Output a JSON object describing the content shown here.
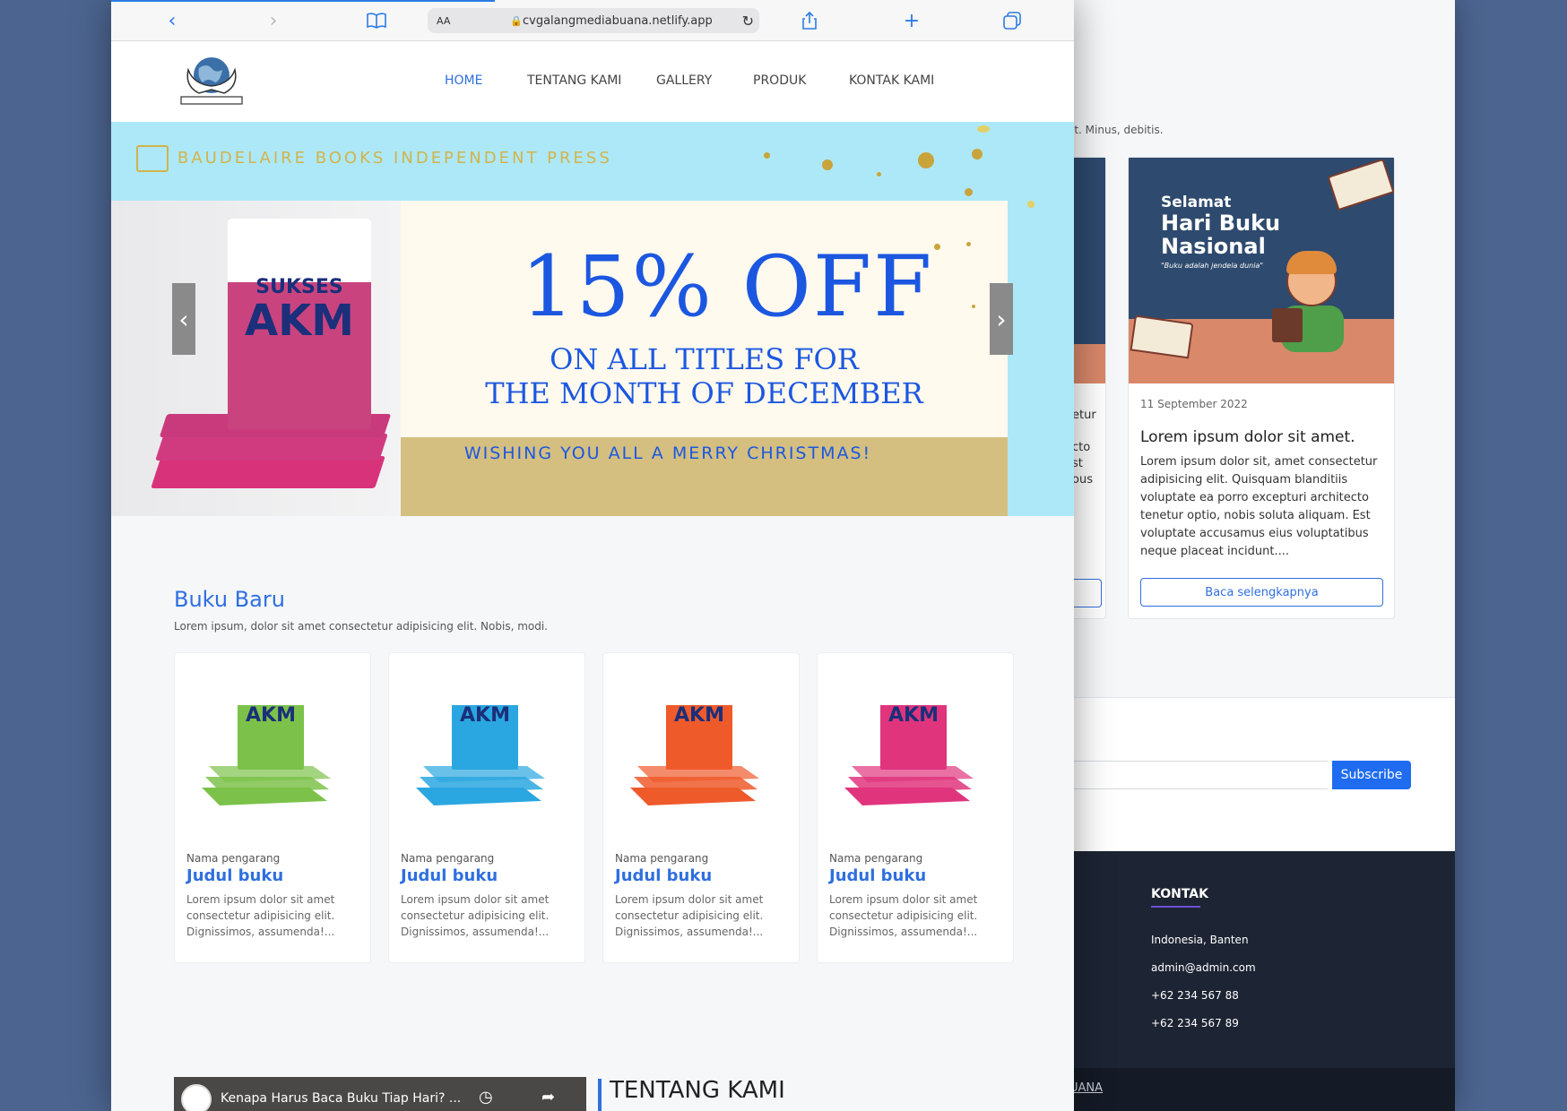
{
  "back": {
    "lead_fragment": "it. Minus, debitis.",
    "left_card_fragments": [
      "etur",
      "cto",
      "st",
      "ous"
    ],
    "main_card": {
      "image_line1": "Selamat",
      "image_line2": "Hari Buku Nasional",
      "image_quote": "\"Buku adalah jendela dunia\"",
      "date": "11 September 2022",
      "title": "Lorem ipsum dolor sit amet.",
      "text": "Lorem ipsum dolor sit, amet consectetur adipisicing elit. Quisquam blanditiis voluptate ea porro excepturi architecto tenetur optio, nobis soluta aliquam. Est voluptate accusamus eius voluptatibus neque placeat incidunt....",
      "button": "Baca selengkapnya"
    },
    "subscribe_button": "Subscribe",
    "footer": {
      "heading": "KONTAK",
      "items": [
        "Indonesia, Banten",
        "admin@admin.com",
        "+62 234 567 88",
        "+62 234 567 89"
      ],
      "bottom_link": "UANA"
    }
  },
  "browser": {
    "url_aa": "AA",
    "url": "cvgalangmediabuana.netlify.app",
    "icons": [
      "back-icon",
      "forward-icon",
      "bookmarks-icon",
      "lock-icon",
      "reload-icon",
      "share-icon",
      "new-tab-icon",
      "tabs-icon"
    ]
  },
  "nav": {
    "items": [
      "HOME",
      "TENTANG KAMI",
      "GALLERY",
      "PRODUK",
      "KONTAK KAMI"
    ],
    "active": "HOME"
  },
  "hero": {
    "brand": "BAUDELAIRE BOOKS INDEPENDENT PRESS",
    "headline": "15% OFF",
    "sub_line1": "ON ALL TITLES FOR",
    "sub_line2": "THE MONTH OF DECEMBER",
    "greeting": "WISHING YOU ALL A MERRY CHRISTMAS!",
    "book_title": "AKM",
    "book_sub": "SUKSES"
  },
  "buku_baru": {
    "heading": "Buku Baru",
    "subtitle": "Lorem ipsum, dolor sit amet consectetur adipisicing elit. Nobis, modi.",
    "books": [
      {
        "author": "Nama pengarang",
        "title": "Judul buku",
        "desc": "Lorem ipsum dolor sit amet consectetur adipisicing elit. Dignissimos, assumenda!...",
        "color": "#7cc24a",
        "label": "AKM"
      },
      {
        "author": "Nama pengarang",
        "title": "Judul buku",
        "desc": "Lorem ipsum dolor sit amet consectetur adipisicing elit. Dignissimos, assumenda!...",
        "color": "#2aa7e0",
        "label": "AKM"
      },
      {
        "author": "Nama pengarang",
        "title": "Judul buku",
        "desc": "Lorem ipsum dolor sit amet consectetur adipisicing elit. Dignissimos, assumenda!...",
        "color": "#ef5a2b",
        "label": "AKM"
      },
      {
        "author": "Nama pengarang",
        "title": "Judul buku",
        "desc": "Lorem ipsum dolor sit amet consectetur adipisicing elit. Dignissimos, assumenda!...",
        "color": "#e0357d",
        "label": "AKM"
      }
    ]
  },
  "video": {
    "title": "Kenapa Harus Baca Buku Tiap Hari? ..."
  },
  "tentang": {
    "heading": "TENTANG KAMI"
  }
}
